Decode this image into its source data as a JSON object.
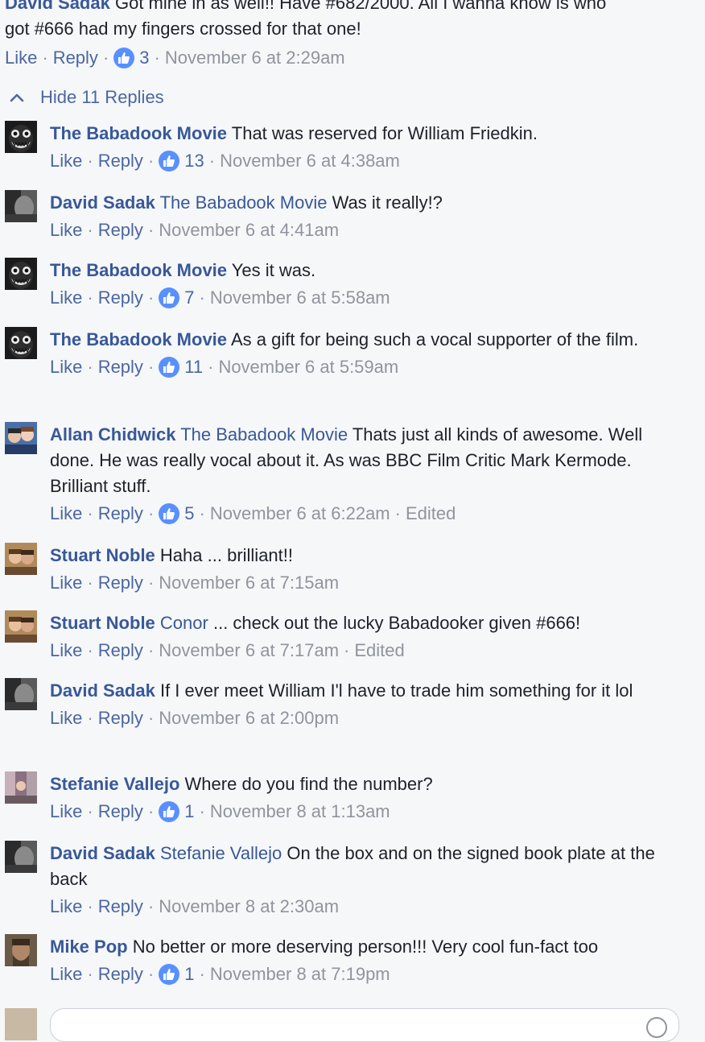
{
  "top_comment": {
    "author": "David Sadak",
    "text_line1": "Got mine in as well!! Have #682/2000. All I wanna know is who",
    "text_line2": "got #666 had my fingers crossed for that one!",
    "like_label": "Like",
    "reply_label": "Reply",
    "likes": "3",
    "timestamp": "November 6 at 2:29am"
  },
  "hide_replies_label": "Hide 11 Replies",
  "replies": [
    {
      "author": "The Babadook Movie",
      "mention": "",
      "text": "That was reserved for William Friedkin.",
      "like_label": "Like",
      "reply_label": "Reply",
      "likes": "13",
      "timestamp": "November 6 at 4:38am",
      "edited": "",
      "avatar": "babadook-avatar"
    },
    {
      "author": "David Sadak",
      "mention": "The Babadook Movie",
      "text": "Was it really!?",
      "like_label": "Like",
      "reply_label": "Reply",
      "likes": "",
      "timestamp": "November 6 at 4:41am",
      "edited": "",
      "avatar": "david-avatar"
    },
    {
      "author": "The Babadook Movie",
      "mention": "",
      "text": "Yes it was.",
      "like_label": "Like",
      "reply_label": "Reply",
      "likes": "7",
      "timestamp": "November 6 at 5:58am",
      "edited": "",
      "avatar": "babadook-avatar"
    },
    {
      "author": "The Babadook Movie",
      "mention": "",
      "text": "As a gift for being such a vocal supporter of the film.",
      "like_label": "Like",
      "reply_label": "Reply",
      "likes": "11",
      "timestamp": "November 6 at 5:59am",
      "edited": "",
      "avatar": "babadook-avatar"
    },
    {
      "author": "Allan Chidwick",
      "mention": "The Babadook Movie",
      "text": "Thats just all kinds of awesome. Well done. He was really vocal about it. As was BBC Film Critic Mark Kermode. Brilliant stuff.",
      "like_label": "Like",
      "reply_label": "Reply",
      "likes": "5",
      "timestamp": "November 6 at 6:22am",
      "edited": "Edited",
      "avatar": "allan-avatar"
    },
    {
      "author": "Stuart Noble",
      "mention": "",
      "text": "Haha ... brilliant!!",
      "like_label": "Like",
      "reply_label": "Reply",
      "likes": "",
      "timestamp": "November 6 at 7:15am",
      "edited": "",
      "avatar": "stuart-avatar"
    },
    {
      "author": "Stuart Noble",
      "mention": "Conor",
      "text": "... check out the lucky Babadooker given #666!",
      "like_label": "Like",
      "reply_label": "Reply",
      "likes": "",
      "timestamp": "November 6 at 7:17am",
      "edited": "Edited",
      "avatar": "stuart-avatar"
    },
    {
      "author": "David Sadak",
      "mention": "",
      "text": "If I ever meet William I'l have to trade him something for it lol",
      "like_label": "Like",
      "reply_label": "Reply",
      "likes": "",
      "timestamp": "November 6 at 2:00pm",
      "edited": "",
      "avatar": "david-avatar"
    },
    {
      "author": "Stefanie Vallejo",
      "mention": "",
      "text": "Where do you find the number?",
      "like_label": "Like",
      "reply_label": "Reply",
      "likes": "1",
      "timestamp": "November 8 at 1:13am",
      "edited": "",
      "avatar": "stefanie-avatar"
    },
    {
      "author": "David Sadak",
      "mention": "Stefanie Vallejo",
      "text": "On the box and on the signed book plate at the back",
      "like_label": "Like",
      "reply_label": "Reply",
      "likes": "",
      "timestamp": "November 8 at 2:30am",
      "edited": "",
      "avatar": "david-avatar"
    },
    {
      "author": "Mike Pop",
      "mention": "",
      "text": "No better or more deserving person!!! Very cool fun-fact too",
      "like_label": "Like",
      "reply_label": "Reply",
      "likes": "1",
      "timestamp": "November 8 at 7:19pm",
      "edited": "",
      "avatar": "mike-avatar"
    }
  ],
  "colors": {
    "link": "#385898",
    "meta": "#90949c",
    "like_badge": "#5890ff",
    "background": "#f6f7f9"
  }
}
